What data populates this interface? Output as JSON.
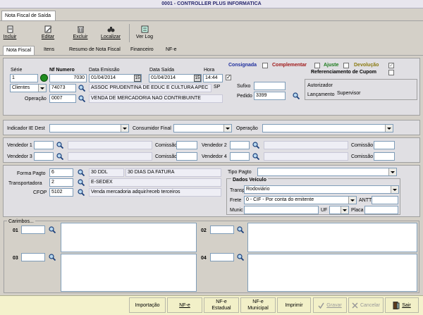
{
  "window": {
    "title": "0001 - CONTROLLER PLUS INFORMATICA"
  },
  "top_tab": "Nota Fiscal de Saída",
  "toolbar": {
    "incluir": "Incluir",
    "editar": "Editar",
    "excluir": "Excluir",
    "localizar": "Localizar",
    "ver_log": "Ver Log"
  },
  "tabs": [
    "Nota Fiscal",
    "Itens",
    "Resumo de Nota Fiscal",
    "Financeiro",
    "NF-e"
  ],
  "header": {
    "serie_label": "Série",
    "serie": "1",
    "nf_label": "Nf Numero",
    "nf": "7030",
    "emissao_label": "Data Emissão",
    "emissao": "01/04/2014",
    "saida_label": "Data Saída",
    "saida": "01/04/2014",
    "hora_label": "Hora",
    "hora": "14:44",
    "destino": "Clientes",
    "cliente_codigo": "74073",
    "cliente_nome": "ASSOC PRUDENTINA DE EDUC E CULTURA APEC",
    "uf": "SP",
    "operacao_label": "Operação",
    "operacao_codigo": "0007",
    "operacao_desc": "VENDA DE MERCADORIA NAO CONTRIBUINTE",
    "consignada": "Consignada",
    "complementar": "Complementar",
    "ajuste": "Ajuste",
    "devolucao": "Devolução",
    "referenciamento": "Referenciamento de Cupom",
    "sufixo_label": "Sufixo",
    "sufixo": "",
    "pedido_label": "Pedido",
    "pedido": "3399",
    "autorizador_label": "Autorizador",
    "autorizador": "",
    "lancamento_label": "Lançamento",
    "lancamento": "Supervisor"
  },
  "indicadores": {
    "ie_label": "Indicador IE Dest",
    "ie": "",
    "cf_label": "Consumidor Final",
    "cf": "",
    "op_label": "Operação",
    "op": ""
  },
  "vendedores": {
    "v1": "Vendedor 1",
    "v2": "Vendedor 2",
    "v3": "Vendedor 3",
    "v4": "Vendedor 4",
    "comissao": "Comissão"
  },
  "pagamento": {
    "forma_label": "Forma Pagto",
    "forma_codigo": "6",
    "forma_sigla": "30 DDL",
    "forma_desc": "30 DIAS DA FATURA",
    "transp_label": "Transportadora",
    "transp_codigo": "2",
    "transp_nome": "E-SEDEX",
    "cfop_label": "CFOP",
    "cfop": "5102",
    "cfop_desc": "Venda mercadoria adquir/receb terceiros",
    "tipo_label": "Tipo Pagto",
    "tipo": ""
  },
  "veiculo": {
    "title": "Dados Veículo",
    "transp_label": "Transp",
    "transp": "Rodoviário",
    "frete_label": "Frete",
    "frete": "0 - CIF - Por conta do emitente",
    "antt_label": "ANTT",
    "munic_label": "Munic",
    "uf_label": "UF",
    "placa_label": "Placa"
  },
  "carimbos": {
    "title": "Carimbos...",
    "n1": "01",
    "n2": "02",
    "n3": "03",
    "n4": "04"
  },
  "bottom": {
    "importacao": "Importação",
    "nfe": "NF-e",
    "nfe_estadual": "NF-e Estadual",
    "nfe_municipal": "NF-e Municipal",
    "imprimir": "Imprimir",
    "gravar": "Gravar",
    "cancelar": "Cancelar",
    "sair": "Sair"
  },
  "colors": {
    "accent": "#2a2a70",
    "consignada": "#1f2f9e",
    "complementar": "#a01818",
    "ajuste": "#1a7a1a",
    "devolucao": "#8a7a10"
  }
}
